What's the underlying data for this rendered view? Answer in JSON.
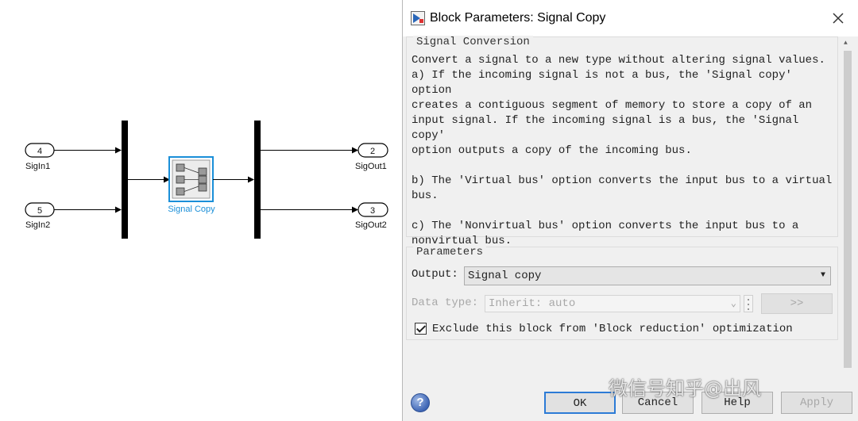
{
  "model": {
    "inports": [
      {
        "number": "4",
        "label": "SigIn1"
      },
      {
        "number": "5",
        "label": "SigIn2"
      }
    ],
    "outports": [
      {
        "number": "2",
        "label": "SigOut1"
      },
      {
        "number": "3",
        "label": "SigOut2"
      }
    ],
    "block_label": "Signal Copy",
    "block_color": "#1a8fd8"
  },
  "dialog": {
    "title": "Block Parameters: Signal Copy",
    "section_title": "Signal Conversion",
    "description": "Convert a signal to a new type without altering signal values.\na) If the incoming signal is not a bus, the 'Signal copy' option\ncreates a contiguous segment of memory to store a copy of an\ninput signal. If the incoming signal is a bus, the 'Signal copy'\noption outputs a copy of the incoming bus.\n\nb) The 'Virtual bus' option converts the input bus to a virtual\nbus.\n\nc) The 'Nonvirtual bus' option converts the input bus to a\nnonvirtual bus.",
    "parameters_title": "Parameters",
    "output_label": "Output:",
    "output_value": "Signal copy",
    "datatype_label": "Data type:",
    "datatype_value": "Inherit: auto",
    "assistant_label": ">>",
    "exclude_label": "Exclude this block from 'Block reduction' optimization",
    "exclude_checked": true,
    "buttons": {
      "ok": "OK",
      "cancel": "Cancel",
      "help": "Help",
      "apply": "Apply"
    },
    "help_icon": "?"
  },
  "watermark": "微信号知乎@出风"
}
